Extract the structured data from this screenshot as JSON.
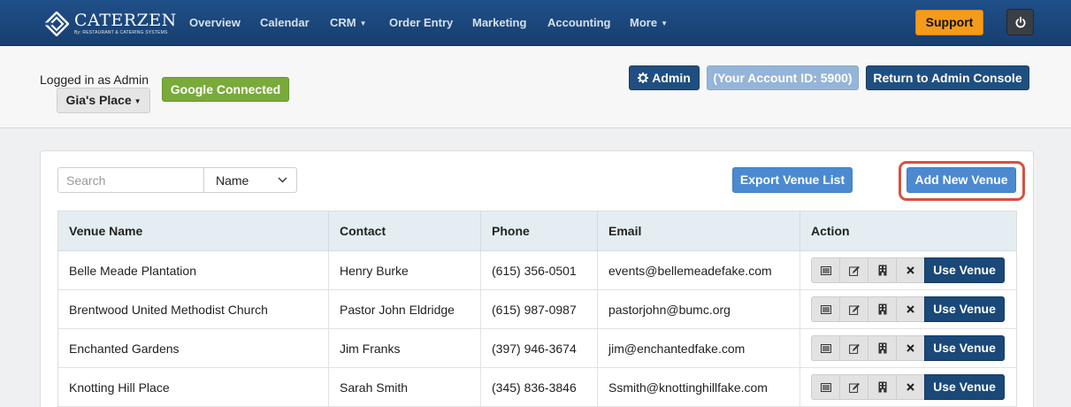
{
  "brand": {
    "name": "CATERZEN",
    "tagline": "By: RESTAURANT & CATERING SYSTEMS"
  },
  "nav": {
    "items": [
      {
        "label": "Overview",
        "dropdown": false
      },
      {
        "label": "Calendar",
        "dropdown": false
      },
      {
        "label": "CRM",
        "dropdown": true
      },
      {
        "label": "Order Entry",
        "dropdown": false
      },
      {
        "label": "Marketing",
        "dropdown": false
      },
      {
        "label": "Accounting",
        "dropdown": false
      },
      {
        "label": "More",
        "dropdown": true
      }
    ],
    "support_label": "Support",
    "power_icon": "power-icon"
  },
  "subheader": {
    "logged_in_text": "Logged in as Admin",
    "place_label": "Gia's Place",
    "google_label": "Google Connected",
    "admin_label": "Admin",
    "account_label": "(Your Account ID: 5900)",
    "return_label": "Return to Admin Console"
  },
  "toolbar": {
    "search_placeholder": "Search",
    "search_value": "",
    "search_by_selected": "Name",
    "export_label": "Export Venue List",
    "add_label": "Add New Venue"
  },
  "table": {
    "columns": [
      "Venue Name",
      "Contact",
      "Phone",
      "Email",
      "Action"
    ],
    "rows": [
      {
        "venue": "Belle Meade Plantation",
        "contact": "Henry Burke",
        "phone": "(615) 356-0501",
        "email": "events@bellemeadefake.com"
      },
      {
        "venue": "Brentwood United Methodist Church",
        "contact": "Pastor John Eldridge",
        "phone": "(615) 987-0987",
        "email": "pastorjohn@bumc.org"
      },
      {
        "venue": "Enchanted Gardens",
        "contact": "Jim Franks",
        "phone": "(397) 946-3674",
        "email": "jim@enchantedfake.com"
      },
      {
        "venue": "Knotting Hill Place",
        "contact": "Sarah Smith",
        "phone": "(345) 836-3846",
        "email": "Ssmith@knottinghillfake.com"
      }
    ],
    "use_label": "Use Venue",
    "action_icons": [
      "list-icon",
      "edit-icon",
      "building-icon",
      "delete-icon"
    ]
  },
  "colors": {
    "nav_bg": "#1f4f88",
    "support": "#f59b1c",
    "google": "#7aaa3a",
    "primary_dark": "#1f4f80",
    "primary_light": "#4b8ad0",
    "highlight": "#d9503f"
  }
}
